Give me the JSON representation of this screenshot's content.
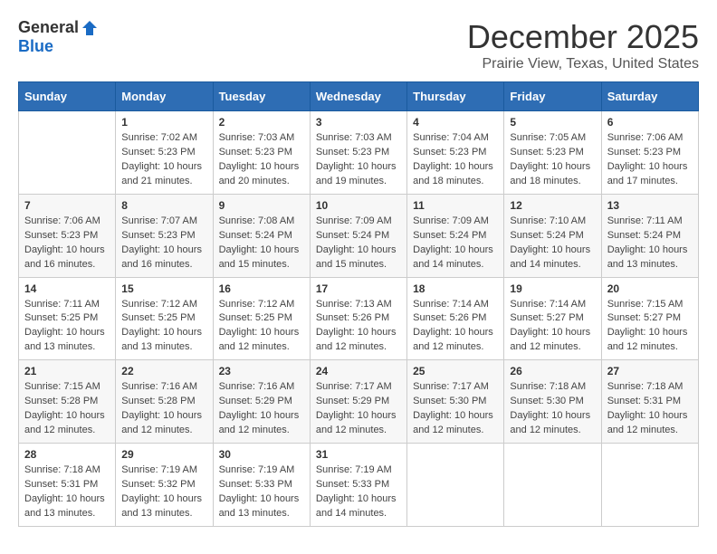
{
  "header": {
    "logo_general": "General",
    "logo_blue": "Blue",
    "title": "December 2025",
    "subtitle": "Prairie View, Texas, United States"
  },
  "calendar": {
    "days_of_week": [
      "Sunday",
      "Monday",
      "Tuesday",
      "Wednesday",
      "Thursday",
      "Friday",
      "Saturday"
    ],
    "weeks": [
      [
        {
          "day": "",
          "info": ""
        },
        {
          "day": "1",
          "info": "Sunrise: 7:02 AM\nSunset: 5:23 PM\nDaylight: 10 hours\nand 21 minutes."
        },
        {
          "day": "2",
          "info": "Sunrise: 7:03 AM\nSunset: 5:23 PM\nDaylight: 10 hours\nand 20 minutes."
        },
        {
          "day": "3",
          "info": "Sunrise: 7:03 AM\nSunset: 5:23 PM\nDaylight: 10 hours\nand 19 minutes."
        },
        {
          "day": "4",
          "info": "Sunrise: 7:04 AM\nSunset: 5:23 PM\nDaylight: 10 hours\nand 18 minutes."
        },
        {
          "day": "5",
          "info": "Sunrise: 7:05 AM\nSunset: 5:23 PM\nDaylight: 10 hours\nand 18 minutes."
        },
        {
          "day": "6",
          "info": "Sunrise: 7:06 AM\nSunset: 5:23 PM\nDaylight: 10 hours\nand 17 minutes."
        }
      ],
      [
        {
          "day": "7",
          "info": "Sunrise: 7:06 AM\nSunset: 5:23 PM\nDaylight: 10 hours\nand 16 minutes."
        },
        {
          "day": "8",
          "info": "Sunrise: 7:07 AM\nSunset: 5:23 PM\nDaylight: 10 hours\nand 16 minutes."
        },
        {
          "day": "9",
          "info": "Sunrise: 7:08 AM\nSunset: 5:24 PM\nDaylight: 10 hours\nand 15 minutes."
        },
        {
          "day": "10",
          "info": "Sunrise: 7:09 AM\nSunset: 5:24 PM\nDaylight: 10 hours\nand 15 minutes."
        },
        {
          "day": "11",
          "info": "Sunrise: 7:09 AM\nSunset: 5:24 PM\nDaylight: 10 hours\nand 14 minutes."
        },
        {
          "day": "12",
          "info": "Sunrise: 7:10 AM\nSunset: 5:24 PM\nDaylight: 10 hours\nand 14 minutes."
        },
        {
          "day": "13",
          "info": "Sunrise: 7:11 AM\nSunset: 5:24 PM\nDaylight: 10 hours\nand 13 minutes."
        }
      ],
      [
        {
          "day": "14",
          "info": "Sunrise: 7:11 AM\nSunset: 5:25 PM\nDaylight: 10 hours\nand 13 minutes."
        },
        {
          "day": "15",
          "info": "Sunrise: 7:12 AM\nSunset: 5:25 PM\nDaylight: 10 hours\nand 13 minutes."
        },
        {
          "day": "16",
          "info": "Sunrise: 7:12 AM\nSunset: 5:25 PM\nDaylight: 10 hours\nand 12 minutes."
        },
        {
          "day": "17",
          "info": "Sunrise: 7:13 AM\nSunset: 5:26 PM\nDaylight: 10 hours\nand 12 minutes."
        },
        {
          "day": "18",
          "info": "Sunrise: 7:14 AM\nSunset: 5:26 PM\nDaylight: 10 hours\nand 12 minutes."
        },
        {
          "day": "19",
          "info": "Sunrise: 7:14 AM\nSunset: 5:27 PM\nDaylight: 10 hours\nand 12 minutes."
        },
        {
          "day": "20",
          "info": "Sunrise: 7:15 AM\nSunset: 5:27 PM\nDaylight: 10 hours\nand 12 minutes."
        }
      ],
      [
        {
          "day": "21",
          "info": "Sunrise: 7:15 AM\nSunset: 5:28 PM\nDaylight: 10 hours\nand 12 minutes."
        },
        {
          "day": "22",
          "info": "Sunrise: 7:16 AM\nSunset: 5:28 PM\nDaylight: 10 hours\nand 12 minutes."
        },
        {
          "day": "23",
          "info": "Sunrise: 7:16 AM\nSunset: 5:29 PM\nDaylight: 10 hours\nand 12 minutes."
        },
        {
          "day": "24",
          "info": "Sunrise: 7:17 AM\nSunset: 5:29 PM\nDaylight: 10 hours\nand 12 minutes."
        },
        {
          "day": "25",
          "info": "Sunrise: 7:17 AM\nSunset: 5:30 PM\nDaylight: 10 hours\nand 12 minutes."
        },
        {
          "day": "26",
          "info": "Sunrise: 7:18 AM\nSunset: 5:30 PM\nDaylight: 10 hours\nand 12 minutes."
        },
        {
          "day": "27",
          "info": "Sunrise: 7:18 AM\nSunset: 5:31 PM\nDaylight: 10 hours\nand 12 minutes."
        }
      ],
      [
        {
          "day": "28",
          "info": "Sunrise: 7:18 AM\nSunset: 5:31 PM\nDaylight: 10 hours\nand 13 minutes."
        },
        {
          "day": "29",
          "info": "Sunrise: 7:19 AM\nSunset: 5:32 PM\nDaylight: 10 hours\nand 13 minutes."
        },
        {
          "day": "30",
          "info": "Sunrise: 7:19 AM\nSunset: 5:33 PM\nDaylight: 10 hours\nand 13 minutes."
        },
        {
          "day": "31",
          "info": "Sunrise: 7:19 AM\nSunset: 5:33 PM\nDaylight: 10 hours\nand 14 minutes."
        },
        {
          "day": "",
          "info": ""
        },
        {
          "day": "",
          "info": ""
        },
        {
          "day": "",
          "info": ""
        }
      ]
    ]
  }
}
